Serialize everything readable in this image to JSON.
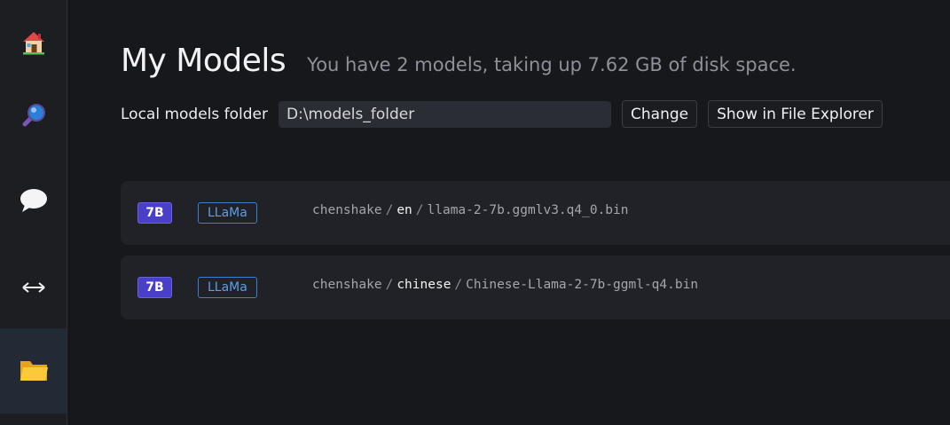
{
  "sidebar": {
    "items": [
      {
        "name": "home",
        "icon": "house-icon"
      },
      {
        "name": "search",
        "icon": "magnifier-icon"
      },
      {
        "name": "chat",
        "icon": "speech-bubble-icon"
      },
      {
        "name": "server",
        "icon": "double-arrow-icon"
      },
      {
        "name": "my-models",
        "icon": "folder-icon",
        "active": true
      }
    ]
  },
  "header": {
    "title": "My Models",
    "subtitle": "You have 2 models, taking up 7.62 GB of disk space."
  },
  "folder": {
    "label": "Local models folder",
    "path": "D:\\models_folder",
    "change_label": "Change",
    "explorer_label": "Show in File Explorer"
  },
  "models": [
    {
      "size": "7B",
      "arch": "LLaMa",
      "author": "chenshake",
      "repo": "en",
      "file": "llama-2-7b.ggmlv3.q4_0.bin"
    },
    {
      "size": "7B",
      "arch": "LLaMa",
      "author": "chenshake",
      "repo": "chinese",
      "file": "Chinese-Llama-2-7b-ggml-q4.bin"
    }
  ],
  "colors": {
    "background": "#16181c",
    "sidebar": "#1c1e22",
    "size_badge": "#4a3fc9",
    "arch_badge": "#5c9ee8"
  }
}
